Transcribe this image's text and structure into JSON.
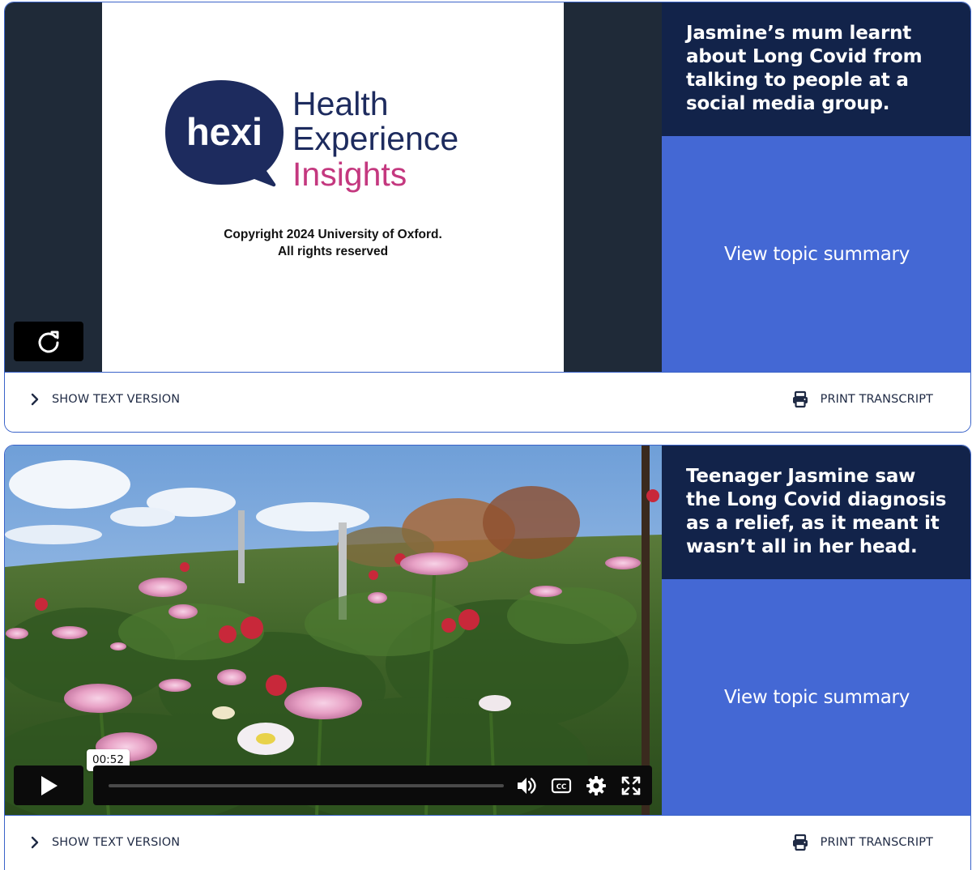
{
  "cards": [
    {
      "headline": "Jasmine’s mum learnt about Long Covid from talking to people at a social media group.",
      "summary_link": "View topic summary",
      "show_text_label": "SHOW TEXT VERSION",
      "print_label": "PRINT TRANSCRIPT",
      "slide": {
        "logo_word": "hexi",
        "logo_line1": "Health",
        "logo_line2": "Experience",
        "logo_line3": "Insights",
        "copyright_line1": "Copyright 2024 University of Oxford.",
        "copyright_line2": "All rights reserved"
      },
      "player_state": "ended",
      "icons": {
        "replay": "replay-icon",
        "chevron": "chevron-right-icon",
        "print": "printer-icon"
      }
    },
    {
      "headline": "Teenager Jasmine saw the Long Covid diagnosis as a relief, as it meant it wasn’t all in her head.",
      "summary_link": "View topic summary",
      "show_text_label": "SHOW TEXT VERSION",
      "print_label": "PRINT TRANSCRIPT",
      "player_state": "paused",
      "seek_tooltip": "00:52",
      "seek_progress": 0,
      "icons": {
        "play": "play-icon",
        "volume": "volume-icon",
        "captions": "closed-captions-icon",
        "settings": "gear-icon",
        "fullscreen": "fullscreen-icon",
        "chevron": "chevron-right-icon",
        "print": "printer-icon"
      }
    }
  ],
  "colors": {
    "headline_bg": "#12234a",
    "summary_bg": "#4468d4",
    "card_border": "#3a63c9",
    "player_side_bars": "#1f2a38",
    "logo_navy": "#1d2b5e",
    "logo_pink": "#c4387f"
  }
}
